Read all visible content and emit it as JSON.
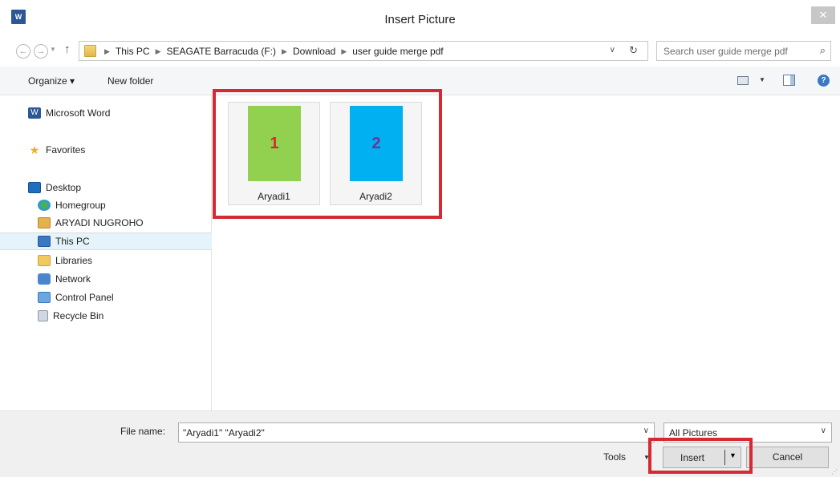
{
  "window": {
    "title": "Insert Picture",
    "app_icon_text": "W"
  },
  "address": {
    "crumbs": [
      "This PC",
      "SEAGATE Barracuda (F:)",
      "Download",
      "user guide merge pdf"
    ],
    "search_placeholder": "Search user guide merge pdf"
  },
  "toolbar": {
    "organize_label": "Organize ▾",
    "new_folder_label": "New folder"
  },
  "nav": {
    "items": [
      {
        "label": "Microsoft Word"
      },
      {
        "label": "Favorites"
      },
      {
        "label": "Desktop"
      },
      {
        "label": "Homegroup"
      },
      {
        "label": "ARYADI NUGROHO"
      },
      {
        "label": "This PC"
      },
      {
        "label": "Libraries"
      },
      {
        "label": "Network"
      },
      {
        "label": "Control Panel"
      },
      {
        "label": "Recycle Bin"
      }
    ]
  },
  "files": [
    {
      "name": "Aryadi1",
      "thumb_text": "1",
      "thumb_color": "#92d050",
      "text_color": "#d42a2a"
    },
    {
      "name": "Aryadi2",
      "thumb_text": "2",
      "thumb_color": "#00b0f0",
      "text_color": "#7030a0"
    }
  ],
  "bottom": {
    "file_name_label": "File name:",
    "file_name_value": "\"Aryadi1\" \"Aryadi2\"",
    "filter_value": "All Pictures",
    "tools_label": "Tools",
    "insert_label": "Insert",
    "cancel_label": "Cancel"
  },
  "colors": {
    "highlight": "#d42a34",
    "selected_bg": "#e5f3fb"
  }
}
